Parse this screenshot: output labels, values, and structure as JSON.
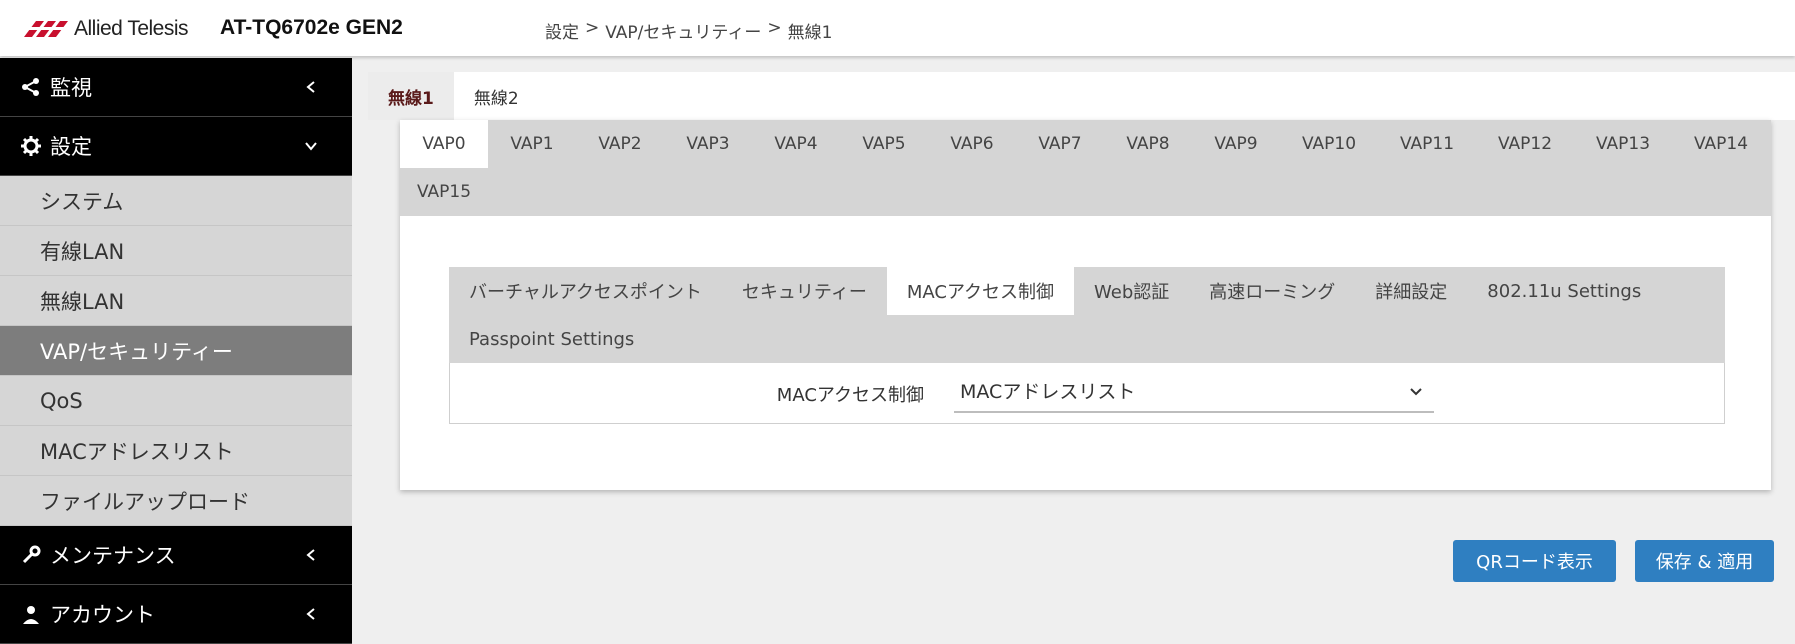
{
  "header": {
    "brand": "Allied Telesis",
    "product": "AT-TQ6702e GEN2",
    "breadcrumb": [
      "設定",
      "VAP/セキュリティー",
      "無線1"
    ],
    "breadcrumb_sep": ">"
  },
  "sidebar": {
    "groups": [
      {
        "label": "監視",
        "icon": "share-icon"
      },
      {
        "label": "設定",
        "icon": "gear-icon"
      },
      {
        "label": "メンテナンス",
        "icon": "wrench-icon"
      },
      {
        "label": "アカウント",
        "icon": "user-icon"
      }
    ],
    "items": [
      {
        "label": "システム"
      },
      {
        "label": "有線LAN"
      },
      {
        "label": "無線LAN"
      },
      {
        "label": "VAP/セキュリティー"
      },
      {
        "label": "QoS"
      },
      {
        "label": "MACアドレスリスト"
      },
      {
        "label": "ファイルアップロード"
      }
    ]
  },
  "radio_tabs": [
    "無線1",
    "無線2"
  ],
  "vap_tabs": [
    "VAP0",
    "VAP1",
    "VAP2",
    "VAP3",
    "VAP4",
    "VAP5",
    "VAP6",
    "VAP7",
    "VAP8",
    "VAP9",
    "VAP10",
    "VAP11",
    "VAP12",
    "VAP13",
    "VAP14",
    "VAP15"
  ],
  "security_tabs": [
    "バーチャルアクセスポイント",
    "セキュリティー",
    "MACアクセス制御",
    "Web認証",
    "高速ローミング",
    "詳細設定",
    "802.11u Settings",
    "Passpoint Settings"
  ],
  "mac_access": {
    "label": "MACアクセス制御",
    "value": "MACアドレスリスト"
  },
  "buttons": {
    "qr": "QRコード表示",
    "save": "保存 & 適用"
  },
  "colors": {
    "accent": "#2f7fc1",
    "sidebar_header": "#000000",
    "sidebar_active": "#7d7d7d",
    "brand_red": "#c8102e"
  }
}
